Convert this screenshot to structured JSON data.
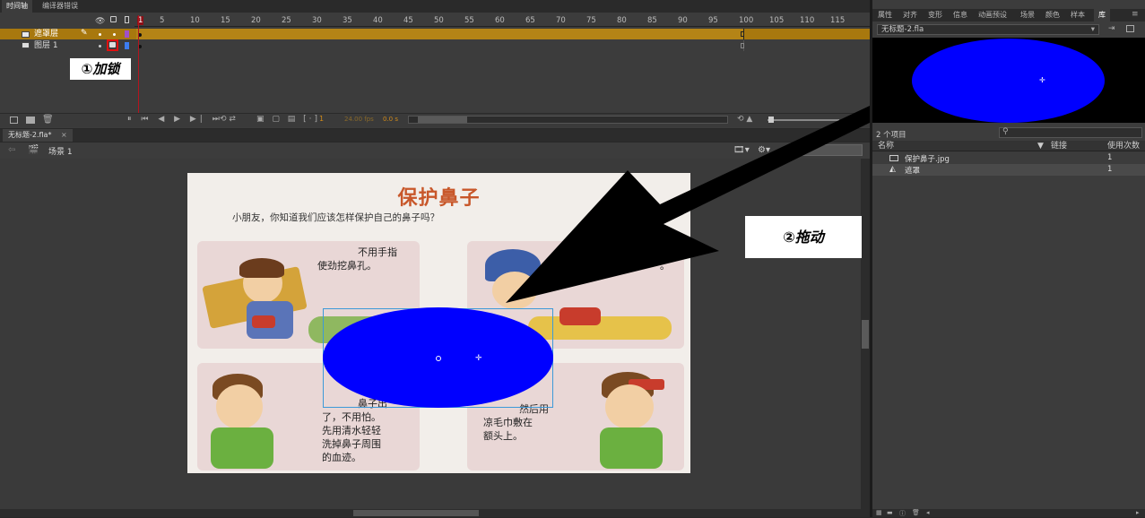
{
  "timeline": {
    "tabs": [
      "时间轴",
      "编译器错误"
    ],
    "frame_numbers": [
      "1",
      "5",
      "10",
      "15",
      "20",
      "25",
      "30",
      "35",
      "40",
      "45",
      "50",
      "55",
      "60",
      "65",
      "70",
      "75",
      "80",
      "85",
      "90",
      "95",
      "100",
      "105",
      "110",
      "115"
    ],
    "layers": [
      {
        "name": "遮罩层"
      },
      {
        "name": "图层 1"
      }
    ],
    "status": {
      "frame": "1",
      "fps": "24.00 fps",
      "time": "0.0 s"
    }
  },
  "document": {
    "tab_label": "无标题-2.fla*",
    "scene_label": "场景 1",
    "zoom_label": "中"
  },
  "annotations": {
    "lock": "①加锁",
    "drag": "②拖动"
  },
  "stage_image": {
    "title": "保护鼻子",
    "subtitle": "小朋友，你知道我们应该怎样保护自己的鼻子吗？",
    "panel1_text": [
      "不用手指",
      "使劲挖鼻孔。"
    ],
    "panel3_text": [
      "鼻子出",
      "了，不用怕。",
      "先用清水轻轻",
      "洗掉鼻子周围",
      "的血迹。"
    ],
    "panel4_text": [
      "然后用",
      "凉毛巾敷在",
      "额头上。"
    ]
  },
  "right_panel": {
    "tabs": [
      "属性",
      "对齐",
      "变形",
      "信息",
      "动画预设",
      "场景",
      "颜色",
      "样本",
      "库"
    ],
    "document_select": "无标题-2.fla",
    "item_count": "2 个项目",
    "search_placeholder": "",
    "columns": {
      "name": "名称",
      "link": "链接",
      "use_count": "使用次数"
    },
    "items": [
      {
        "name": "保护鼻子.jpg",
        "count": "1",
        "icon": "bitmap-icon"
      },
      {
        "name": "遮罩",
        "count": "1",
        "icon": "graphic-symbol-icon"
      }
    ]
  },
  "colors": {
    "accent_orange": "#a8780e",
    "playhead_red": "#b4141e",
    "ellipse_blue": "#0000ff",
    "selection_blue": "#3d9ad8"
  }
}
